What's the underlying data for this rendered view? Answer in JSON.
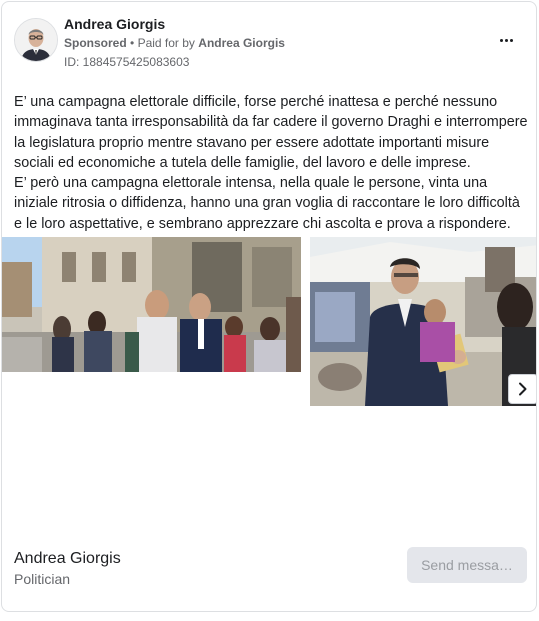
{
  "header": {
    "advertiser_name": "Andrea Giorgis",
    "sponsored_label": "Sponsored",
    "separator": "•",
    "paid_for_prefix": "Paid for by",
    "paid_for_name": "Andrea Giorgis",
    "ad_id": "ID: 1884575425083603",
    "more_icon": "more-horizontal-icon"
  },
  "body": {
    "text": "E’ una campagna elettorale difficile, forse perché inattesa e perché nessuno immaginava tanta irresponsabilità da far cadere il governo Draghi e interrompere la legislatura proprio mentre stavano per essere adottate importanti misure sociali ed economiche a tutela delle famiglie, del lavoro e delle imprese.\nE’ però una campagna elettorale intensa, nella quale le persone, vinta una iniziale ritrosia o diffidenza, hanno una gran voglia di raccontare le loro difficoltà e le loro aspettative, e sembrano apprezzare chi ascolta e prova a rispondere. Così è stato…"
  },
  "carousel": {
    "photos": [
      {
        "name": "street-campaign-photo"
      },
      {
        "name": "market-campaign-photo"
      }
    ],
    "next_icon": "chevron-right-icon"
  },
  "footer": {
    "page_name": "Andrea Giorgis",
    "page_category": "Politician",
    "send_button_label": "Send messa…"
  },
  "colors": {
    "text_primary": "#1c1e21",
    "text_secondary": "#65676b",
    "border": "#dddfe2",
    "button_bg": "#e4e6eb",
    "button_text": "#9a9da2"
  }
}
